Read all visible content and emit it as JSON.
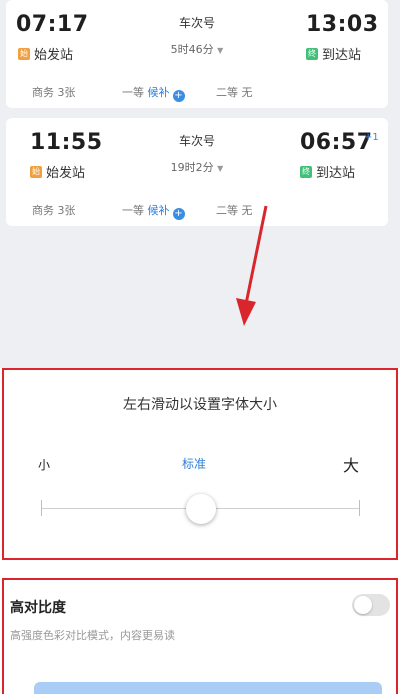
{
  "trains": [
    {
      "depart_time": "07:17",
      "arrive_time": "13:03",
      "arrive_day_offset": "",
      "train_no": "车次号",
      "duration": "5时46分",
      "start_station": "始发站",
      "end_station": "到达站",
      "seats": {
        "business": "商务",
        "business_count": "3张",
        "first": "一等",
        "first_status": "候补",
        "second": "二等",
        "second_status": "无"
      }
    },
    {
      "depart_time": "11:55",
      "arrive_time": "06:57",
      "arrive_day_offset": "+1",
      "train_no": "车次号",
      "duration": "19时2分",
      "start_station": "始发站",
      "end_station": "到达站",
      "seats": {
        "business": "商务",
        "business_count": "3张",
        "first": "一等",
        "first_status": "候补",
        "second": "二等",
        "second_status": "无"
      }
    }
  ],
  "font_size_setting": {
    "title": "左右滑动以设置字体大小",
    "small_label": "小",
    "standard_label": "标准",
    "large_label": "大",
    "current_level": "标准",
    "level_index": 2,
    "level_count": 5
  },
  "high_contrast": {
    "title": "高对比度",
    "description": "高强度色彩对比模式，内容更易读",
    "enabled": false
  },
  "colors": {
    "accent": "#2f7fd8",
    "highlight_box": "#d9262c",
    "arrow": "#d9262c"
  }
}
